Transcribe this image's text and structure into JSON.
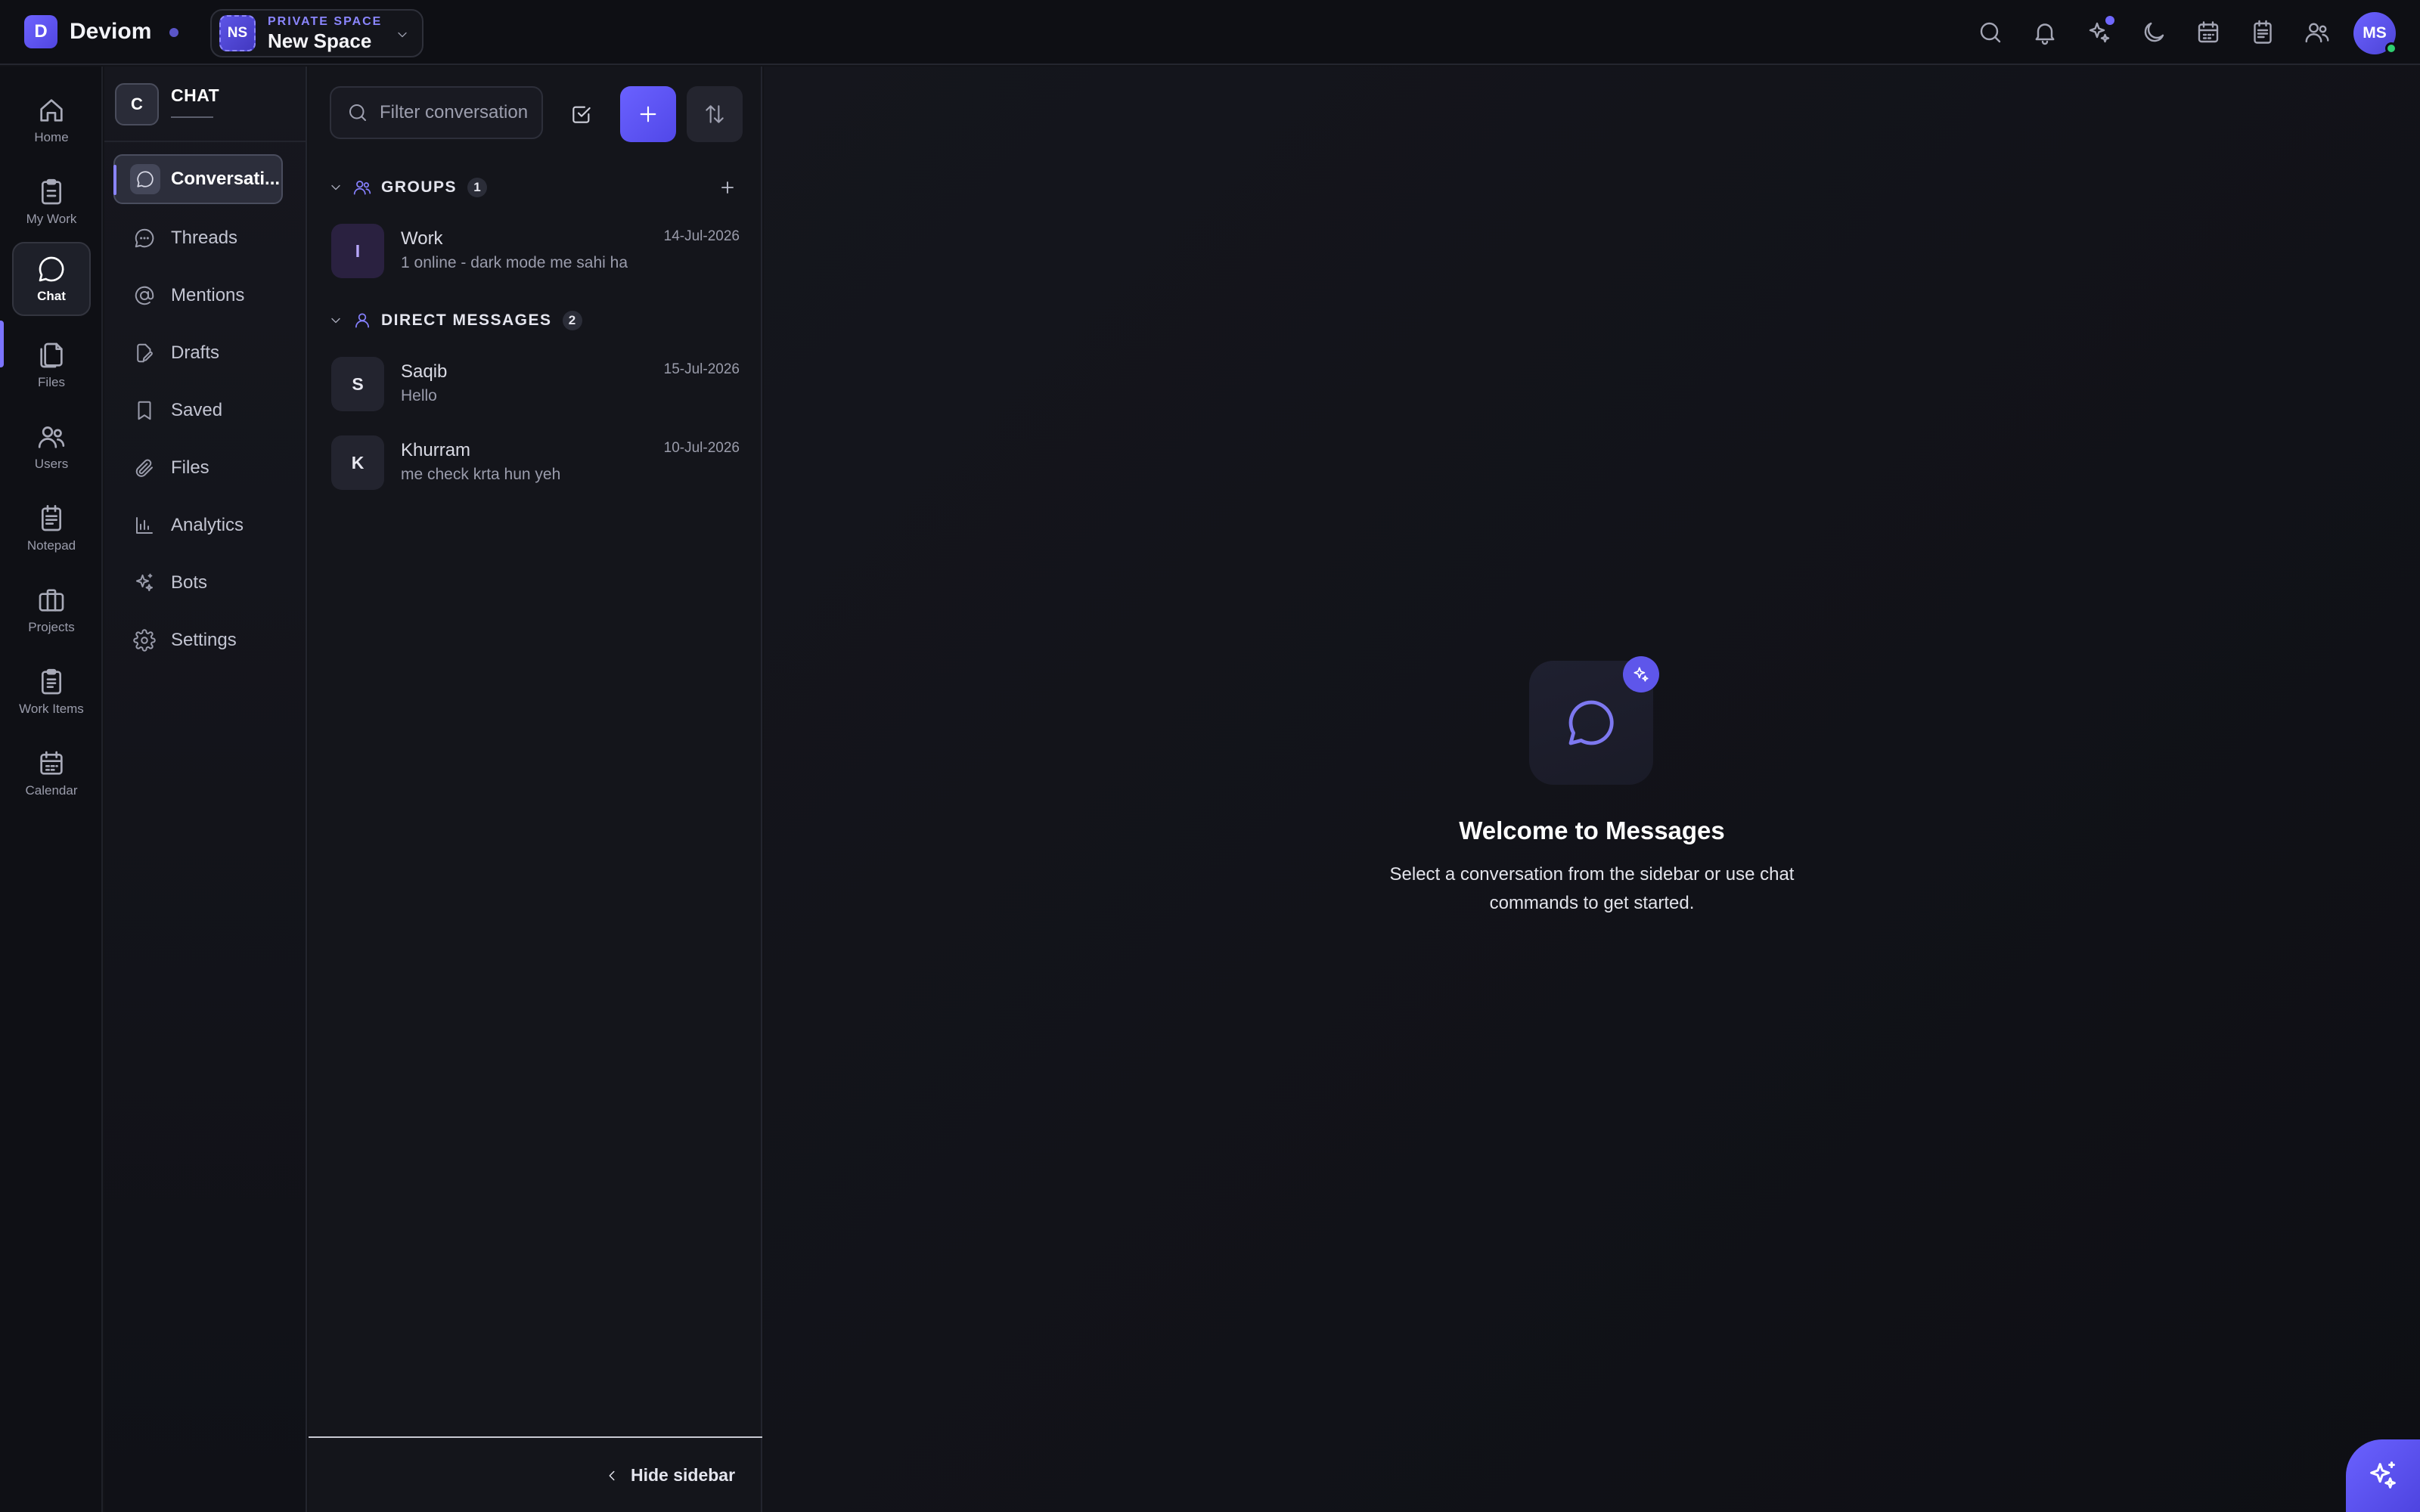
{
  "app": {
    "brand_initial": "D",
    "brand_name": "Deviom"
  },
  "space": {
    "initials": "NS",
    "kicker": "PRIVATE SPACE",
    "name": "New Space"
  },
  "topbar": {
    "icons": [
      "search-icon",
      "bell-icon",
      "sparkle-icon",
      "moon-icon",
      "calendar-icon",
      "notepad-icon",
      "users-icon"
    ],
    "user_initials": "MS"
  },
  "rail": {
    "items": [
      {
        "label": "Home",
        "icon": "home-icon"
      },
      {
        "label": "My Work",
        "icon": "clipboard-icon"
      },
      {
        "label": "Chat",
        "icon": "chat-icon",
        "active": true
      },
      {
        "label": "Files",
        "icon": "files-icon"
      },
      {
        "label": "Users",
        "icon": "users-icon"
      },
      {
        "label": "Notepad",
        "icon": "notepad-icon"
      },
      {
        "label": "Projects",
        "icon": "briefcase-icon"
      },
      {
        "label": "Work Items",
        "icon": "clipboard-list-icon"
      },
      {
        "label": "Calendar",
        "icon": "calendar-icon"
      }
    ]
  },
  "subnav": {
    "badge": "C",
    "title": "CHAT",
    "items": [
      {
        "label": "Conversati...",
        "icon": "chat-icon",
        "active": true
      },
      {
        "label": "Threads",
        "icon": "threads-icon"
      },
      {
        "label": "Mentions",
        "icon": "at-icon"
      },
      {
        "label": "Drafts",
        "icon": "draft-icon"
      },
      {
        "label": "Saved",
        "icon": "bookmark-icon"
      },
      {
        "label": "Files",
        "icon": "paperclip-icon"
      },
      {
        "label": "Analytics",
        "icon": "bar-chart-icon"
      },
      {
        "label": "Bots",
        "icon": "sparkle-icon"
      },
      {
        "label": "Settings",
        "icon": "gear-icon"
      }
    ]
  },
  "conversations": {
    "filter_placeholder": "Filter conversation",
    "groups": {
      "label": "GROUPS",
      "count": "1",
      "items": [
        {
          "initial": "I",
          "name": "Work",
          "preview": "1 online - dark mode me sahi ha",
          "date": "14-Jul-2026"
        }
      ]
    },
    "direct": {
      "label": "DIRECT MESSAGES",
      "count": "2",
      "items": [
        {
          "initial": "S",
          "name": "Saqib",
          "preview": "Hello",
          "date": "15-Jul-2026"
        },
        {
          "initial": "K",
          "name": "Khurram",
          "preview": "me check krta hun yeh",
          "date": "10-Jul-2026"
        }
      ]
    },
    "hide_label": "Hide sidebar"
  },
  "main": {
    "welcome_title": "Welcome to Messages",
    "welcome_text": "Select a conversation from the sidebar or use chat commands to get started."
  },
  "colors": {
    "accent": "#6a61ff",
    "background": "#121318",
    "online": "#2fcf71"
  }
}
